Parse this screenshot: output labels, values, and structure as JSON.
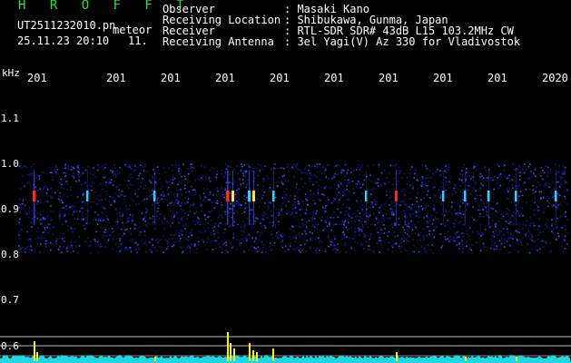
{
  "header": {
    "logo": "H R O F F T",
    "file_name": "UT2511232010.pn",
    "meteor_label": "meteor",
    "date_time": "25.11.23 20:10",
    "count": "11.",
    "fields": [
      {
        "label": "Observer",
        "value": ": Masaki Kano"
      },
      {
        "label": "Receiving Location",
        "value": ": Shibukawa, Gunma, Japan"
      },
      {
        "label": "Receiver",
        "value": ": RTL-SDR SDR# 43dB L15 103.2MHz CW"
      },
      {
        "label": "Receiving Antenna",
        "value": ": 3el Yagi(V) Az 330 for Vladivostok"
      }
    ]
  },
  "axis": {
    "unit": "kHz",
    "time_labels": [
      "201",
      "201",
      "201",
      "201",
      "201",
      "201",
      "201",
      "201",
      "201",
      "2020"
    ],
    "freq_labels": [
      "1.1",
      "1.0",
      "0.9",
      "0.8",
      "0.7",
      "0.6"
    ]
  },
  "colors": {
    "background": "#000000",
    "logo": "#27e23f",
    "noise_dark": "#0a1b8c",
    "noise_light": "#2a55ff",
    "echo_hot": "#ff2a2a",
    "echo_warm": "#ffe04a",
    "echo_cool": "#2bd4ff",
    "level_bar": "#f7f02a",
    "level_base": "#20d6e0"
  }
}
